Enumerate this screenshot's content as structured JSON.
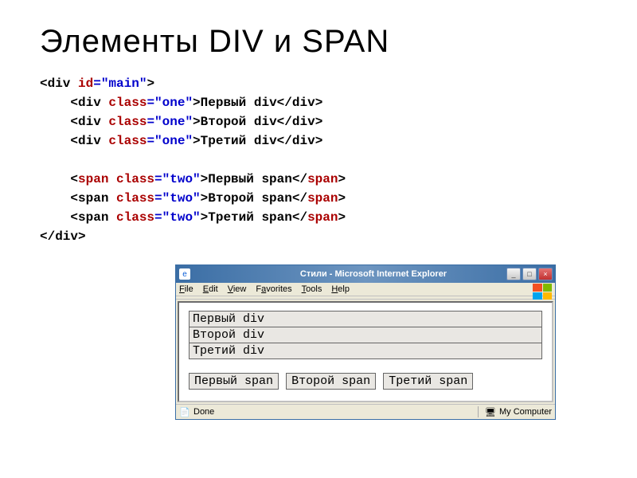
{
  "title": "Элементы DIV и SPAN",
  "code": {
    "l1a": "<div ",
    "l1b": "id",
    "l1c": "=\"main\"",
    "l1d": ">",
    "l2a": "    <div ",
    "l2b": "class",
    "l2c": "=\"one\"",
    "l2d": ">Первый div</",
    "l2e": "div",
    "l2f": ">",
    "l3a": "    <div ",
    "l3b": "class",
    "l3c": "=\"one\"",
    "l3d": ">Второй div</",
    "l3e": "div",
    "l3f": ">",
    "l4a": "    <div ",
    "l4b": "class",
    "l4c": "=\"one\"",
    "l4d": ">Третий div</",
    "l4e": "div",
    "l4f": ">",
    "l5a": "    <",
    "l5b": "span class",
    "l5c": "=\"two\"",
    "l5d": ">Первый span</",
    "l5e": "span",
    "l5f": ">",
    "l6a": "    <span ",
    "l6b": "class",
    "l6c": "=\"two\"",
    "l6d": ">Второй span</",
    "l6e": "span",
    "l6f": ">",
    "l7a": "    <span ",
    "l7b": "class",
    "l7c": "=\"two\"",
    "l7d": ">Третий span</",
    "l7e": "span",
    "l7f": ">",
    "l8": "</div>"
  },
  "ie": {
    "title": "Стили - Microsoft Internet Explorer",
    "menu": {
      "file": "File",
      "edit": "Edit",
      "view": "View",
      "favorites": "Favorites",
      "tools": "Tools",
      "help": "Help"
    }
  },
  "output": {
    "divs": [
      "Первый div",
      "Второй div",
      "Третий div"
    ],
    "spans": [
      "Первый span",
      "Второй span",
      "Третий span"
    ]
  },
  "status": {
    "done": "Done",
    "mycomputer": "My Computer"
  }
}
